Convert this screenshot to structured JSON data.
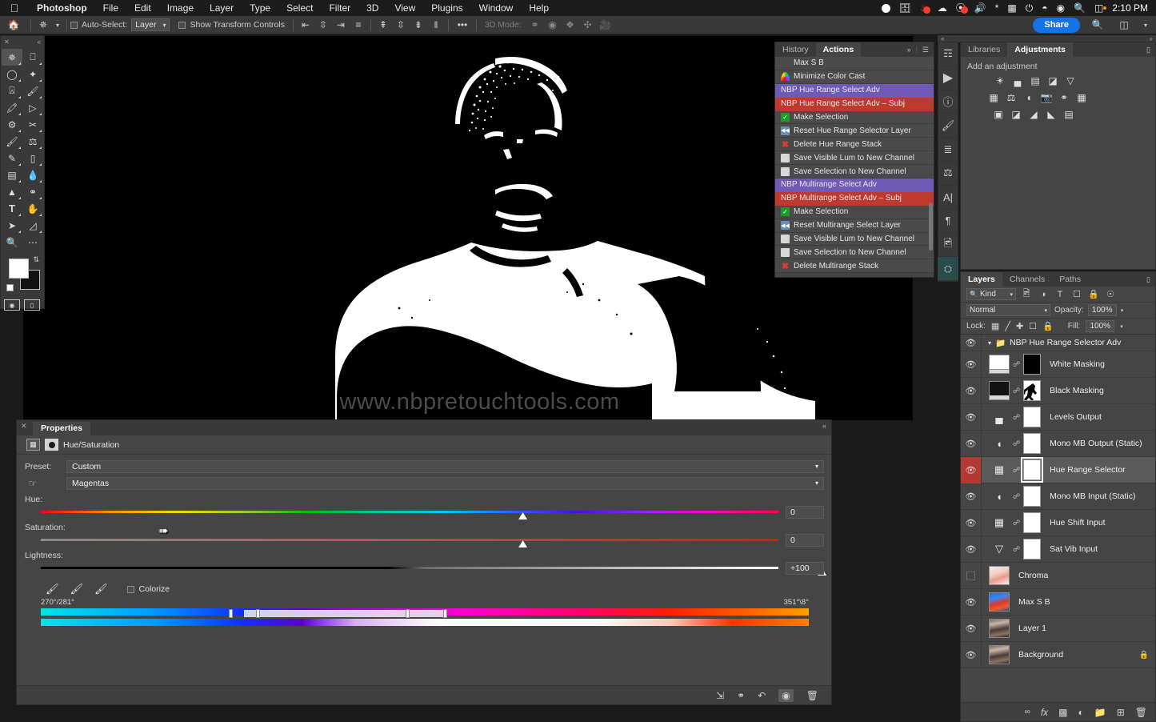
{
  "app": {
    "name": "Photoshop",
    "clock": "2:10 PM"
  },
  "menubar": {
    "items": [
      "Photoshop",
      "File",
      "Edit",
      "Image",
      "Layer",
      "Type",
      "Select",
      "Filter",
      "3D",
      "View",
      "Plugins",
      "Help"
    ]
  },
  "status_icons": [
    "record-icon",
    "screen-share-icon",
    "users-badge-icon",
    "cloud-icon",
    "cleaner-badge-icon",
    "volume-icon",
    "bluetooth-icon",
    "battery-case-icon",
    "battery-charging-icon",
    "wifi-icon",
    "control-center-icon",
    "spotlight-search-icon",
    "server-icon"
  ],
  "options_bar": {
    "home_icon": "home-icon",
    "tool_icon": "move-tool-icon",
    "auto_select_label": "Auto-Select:",
    "auto_select_value": "Layer",
    "show_transform_label": "Show Transform Controls",
    "align_icons": [
      "align-left-edges",
      "align-horizontal-centers",
      "align-right-edges",
      "align-top-edges"
    ],
    "distribute_icons": [
      "distribute-top-edges",
      "distribute-vertical-centers",
      "distribute-bottom-edges",
      "distribute-horizontal"
    ],
    "more_label": "•••",
    "mode3d_label": "3D Mode:",
    "mode3d_icons": [
      "orbit-3d-icon",
      "roll-3d-icon",
      "pan-3d-icon",
      "slide-3d-icon",
      "camera-3d-icon"
    ],
    "share_label": "Share",
    "search_icon": "search-icon",
    "workspace_icon": "workspace-switcher-icon"
  },
  "toolbar": {
    "tools": [
      {
        "name": "move-tool",
        "glyph": "✥",
        "selected": true
      },
      {
        "name": "rectangular-marquee-tool",
        "glyph": "⬚",
        "selected": false
      },
      {
        "name": "lasso-tool",
        "glyph": "⤵",
        "selected": false
      },
      {
        "name": "object-selection-tool",
        "glyph": "✦",
        "selected": false
      },
      {
        "name": "crop-tool",
        "glyph": "⌗",
        "selected": false
      },
      {
        "name": "eyedropper-tool",
        "glyph": "✒",
        "selected": false
      },
      {
        "name": "spot-healing-brush-tool",
        "glyph": "✐",
        "selected": false
      },
      {
        "name": "patch-tool",
        "glyph": "✏",
        "selected": false
      },
      {
        "name": "gear-select-tool",
        "glyph": "⚙",
        "selected": false
      },
      {
        "name": "scissors-tool",
        "glyph": "✂",
        "selected": false
      },
      {
        "name": "brush-tool",
        "glyph": "╱",
        "selected": false
      },
      {
        "name": "clone-stamp-tool",
        "glyph": "⚓",
        "selected": false
      },
      {
        "name": "history-brush-tool",
        "glyph": "✒",
        "selected": false
      },
      {
        "name": "eraser-tool",
        "glyph": "▱",
        "selected": false
      },
      {
        "name": "gradient-tool",
        "glyph": "▤",
        "selected": false
      },
      {
        "name": "blur-tool",
        "glyph": "●",
        "selected": false
      },
      {
        "name": "dodge-tool",
        "glyph": "▲",
        "selected": false
      },
      {
        "name": "sponge-tool",
        "glyph": "◍",
        "selected": false
      },
      {
        "name": "type-tool",
        "glyph": "T",
        "selected": false
      },
      {
        "name": "pen-tool",
        "glyph": "✎",
        "selected": false
      },
      {
        "name": "path-selection-tool",
        "glyph": "➤",
        "selected": false
      },
      {
        "name": "shape-tool",
        "glyph": "◕",
        "selected": false
      },
      {
        "name": "zoom-tool",
        "glyph": "⌕",
        "selected": false
      },
      {
        "name": "edit-toolbar-tool",
        "glyph": "⋯",
        "selected": false
      }
    ],
    "foreground_color": "#ffffff",
    "background_color": "#111111",
    "quick_mask_icon": "quick-mask-icon",
    "screen_mode_icon": "screen-mode-icon"
  },
  "canvas": {
    "watermark": "www.nbpretouchtools.com",
    "background": "#000000"
  },
  "actions_panel": {
    "tabs": [
      {
        "label": "History",
        "active": false
      },
      {
        "label": "Actions",
        "active": true
      }
    ],
    "overflow_icon": "»",
    "menu_icon": "panel-menu-icon",
    "rows": [
      {
        "label": "Max S B",
        "style": "plain",
        "icon": "none"
      },
      {
        "label": "Minimize Color Cast",
        "style": "plain",
        "icon": "rainbow"
      },
      {
        "label": "NBP Hue Range Select Adv",
        "style": "purple",
        "icon": "none"
      },
      {
        "label": "NBP Hue Range Select Adv – Subj",
        "style": "red",
        "icon": "none"
      },
      {
        "label": "Make Selection",
        "style": "plain",
        "icon": "check"
      },
      {
        "label": "Reset Hue Range Selector Layer",
        "style": "plain",
        "icon": "blue"
      },
      {
        "label": "Delete Hue Range Stack",
        "style": "plain",
        "icon": "x"
      },
      {
        "label": "Save Visible Lum to New Channel",
        "style": "plain",
        "icon": "save"
      },
      {
        "label": "Save Selection to New Channel",
        "style": "plain",
        "icon": "save"
      },
      {
        "label": "NBP Multirange Select Adv",
        "style": "purple",
        "icon": "none"
      },
      {
        "label": "NBP Multirange Select Adv – Subj",
        "style": "red",
        "icon": "none"
      },
      {
        "label": "Make Selection",
        "style": "plain",
        "icon": "check"
      },
      {
        "label": "Reset Multirange Select Layer",
        "style": "plain",
        "icon": "blue"
      },
      {
        "label": "Save Visible Lum to New Channel",
        "style": "plain",
        "icon": "save"
      },
      {
        "label": "Save Selection to New Channel",
        "style": "plain",
        "icon": "save"
      },
      {
        "label": "Delete Multirange Stack",
        "style": "plain",
        "icon": "x"
      }
    ]
  },
  "rail_icons": [
    "libraries-icon",
    "play-actions-icon",
    "info-icon",
    "brush-settings-icon",
    "adjustments-sliders-icon",
    "clone-source-icon",
    "character-icon",
    "paragraph-icon",
    "notes-icon",
    "properties-icon"
  ],
  "adjustments_panel": {
    "tabs": [
      {
        "label": "Libraries",
        "active": false
      },
      {
        "label": "Adjustments",
        "active": true
      }
    ],
    "hint": "Add an adjustment",
    "row1": [
      "brightness-contrast-icon",
      "levels-icon",
      "curves-icon",
      "exposure-icon",
      "vibrance-icon"
    ],
    "row2": [
      "hue-saturation-icon",
      "color-balance-icon",
      "black-white-icon",
      "photo-filter-icon",
      "channel-mixer-icon",
      "color-lookup-icon"
    ],
    "row3": [
      "invert-icon",
      "posterize-icon",
      "threshold-icon",
      "selective-color-icon",
      "gradient-map-icon"
    ]
  },
  "layers_panel": {
    "tabs": [
      {
        "label": "Layers",
        "active": true
      },
      {
        "label": "Channels",
        "active": false
      },
      {
        "label": "Paths",
        "active": false
      }
    ],
    "filter_kind_label": "Kind",
    "filter_icons": [
      "filter-pixel-icon",
      "filter-adjustment-icon",
      "filter-type-icon",
      "filter-shape-icon",
      "filter-smart-icon",
      "filter-toggle-icon"
    ],
    "blend_mode": "Normal",
    "opacity_label": "Opacity:",
    "opacity_value": "100%",
    "lock_label": "Lock:",
    "lock_icons": [
      "lock-transparent-icon",
      "lock-image-icon",
      "lock-position-icon",
      "lock-artboard-icon",
      "lock-all-icon"
    ],
    "fill_label": "Fill:",
    "fill_value": "100%",
    "group": {
      "name": "NBP Hue Range Selector Adv",
      "visible": true,
      "expanded": true
    },
    "layers": [
      {
        "name": "White Masking",
        "visible": true,
        "selected": false,
        "thumb": "white",
        "mask": "black",
        "type": "mask-pair"
      },
      {
        "name": "Black Masking",
        "visible": true,
        "selected": false,
        "thumb": "black",
        "mask": "figure",
        "type": "mask-pair"
      },
      {
        "name": "Levels Output",
        "visible": true,
        "selected": false,
        "thumb": "levels-icon",
        "mask": "white",
        "type": "adjustment"
      },
      {
        "name": "Mono MB Output (Static)",
        "visible": true,
        "selected": false,
        "thumb": "black-white-icon",
        "mask": "white",
        "type": "adjustment"
      },
      {
        "name": "Hue Range Selector",
        "visible": true,
        "selected": true,
        "thumb": "hue-saturation-icon",
        "mask": "white",
        "type": "adjustment"
      },
      {
        "name": "Mono MB Input (Static)",
        "visible": true,
        "selected": false,
        "thumb": "black-white-icon",
        "mask": "white",
        "type": "adjustment"
      },
      {
        "name": "Hue Shift Input",
        "visible": true,
        "selected": false,
        "thumb": "hue-saturation-icon",
        "mask": "white",
        "type": "adjustment"
      },
      {
        "name": "Sat Vib Input",
        "visible": true,
        "selected": false,
        "thumb": "vibrance-icon",
        "mask": "white",
        "type": "adjustment"
      },
      {
        "name": "Chroma",
        "visible": false,
        "selected": false,
        "thumb": "photo-chroma",
        "type": "pixel"
      },
      {
        "name": "Max S B",
        "visible": true,
        "selected": false,
        "thumb": "photo-maxsb",
        "type": "pixel"
      },
      {
        "name": "Layer 1",
        "visible": true,
        "selected": false,
        "thumb": "photo-portrait",
        "type": "pixel"
      },
      {
        "name": "Background",
        "visible": true,
        "selected": false,
        "thumb": "photo-portrait",
        "type": "pixel",
        "locked": true
      }
    ],
    "footer_icons": [
      "link-layers-icon",
      "layer-style-fx-icon",
      "add-mask-icon",
      "new-adjustment-icon",
      "new-group-icon",
      "new-layer-icon",
      "delete-layer-icon"
    ]
  },
  "properties_panel": {
    "tab_label": "Properties",
    "title": "Hue/Saturation",
    "icons": [
      "hue-saturation-icon",
      "mask-thumbnail-icon"
    ],
    "preset_label": "Preset:",
    "preset_value": "Custom",
    "channel_value": "Magentas",
    "hand_icon": "on-image-adjust-icon",
    "sliders": [
      {
        "label": "Hue:",
        "value": "0",
        "knob_pct": 62
      },
      {
        "label": "Saturation:",
        "value": "0",
        "knob_pct": 62
      },
      {
        "label": "Lightness:",
        "value": "+100",
        "knob_pct": 100
      }
    ],
    "eyedropper_icons": [
      "eyedropper-icon",
      "eyedropper-add-icon",
      "eyedropper-subtract-icon"
    ],
    "colorize_label": "Colorize",
    "colorize_checked": false,
    "range_left_label": "270°/281°",
    "range_right_label": "351°\\8°",
    "range_handles_pct": [
      25,
      28,
      47.5,
      52.5
    ],
    "footer_icons": [
      "clip-to-layer-icon",
      "view-previous-state-icon",
      "reset-icon",
      "toggle-visibility-icon",
      "delete-icon"
    ]
  }
}
